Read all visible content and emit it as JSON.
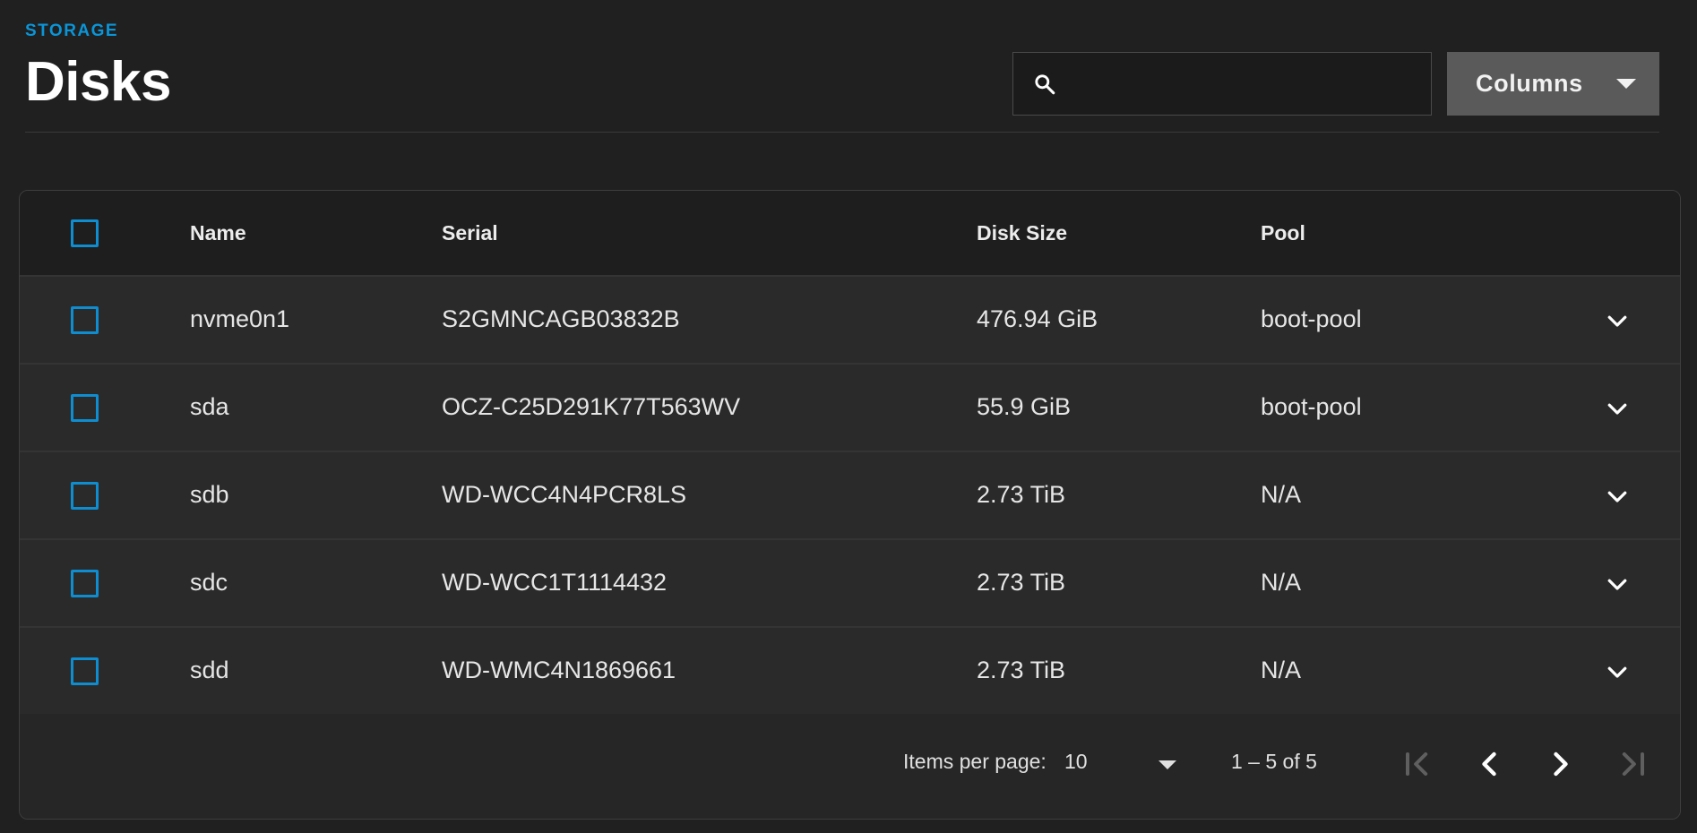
{
  "header": {
    "eyebrow": "STORAGE",
    "title": "Disks",
    "search_placeholder": "",
    "columns_label": "Columns"
  },
  "table": {
    "columns": [
      "Name",
      "Serial",
      "Disk Size",
      "Pool"
    ],
    "rows": [
      {
        "name": "nvme0n1",
        "serial": "S2GMNCAGB03832B",
        "size": "476.94 GiB",
        "pool": "boot-pool"
      },
      {
        "name": "sda",
        "serial": "OCZ-C25D291K77T563WV",
        "size": "55.9 GiB",
        "pool": "boot-pool"
      },
      {
        "name": "sdb",
        "serial": "WD-WCC4N4PCR8LS",
        "size": "2.73 TiB",
        "pool": "N/A"
      },
      {
        "name": "sdc",
        "serial": "WD-WCC1T1114432",
        "size": "2.73 TiB",
        "pool": "N/A"
      },
      {
        "name": "sdd",
        "serial": "WD-WMC4N1869661",
        "size": "2.73 TiB",
        "pool": "N/A"
      }
    ]
  },
  "paginator": {
    "items_per_page_label": "Items per page:",
    "items_per_page_value": "10",
    "range_label": "1 – 5 of 5"
  },
  "colors": {
    "accent": "#0a95d8",
    "checkbox": "#0e8dd0",
    "background": "#202020",
    "button": "#5a5a5a"
  },
  "icons": {
    "search": "search-icon",
    "columns_caret": "caret-down-icon",
    "row_expand": "chevron-down-icon",
    "first_page": "first-page-icon",
    "prev_page": "chevron-left-icon",
    "next_page": "chevron-right-icon",
    "last_page": "last-page-icon"
  }
}
